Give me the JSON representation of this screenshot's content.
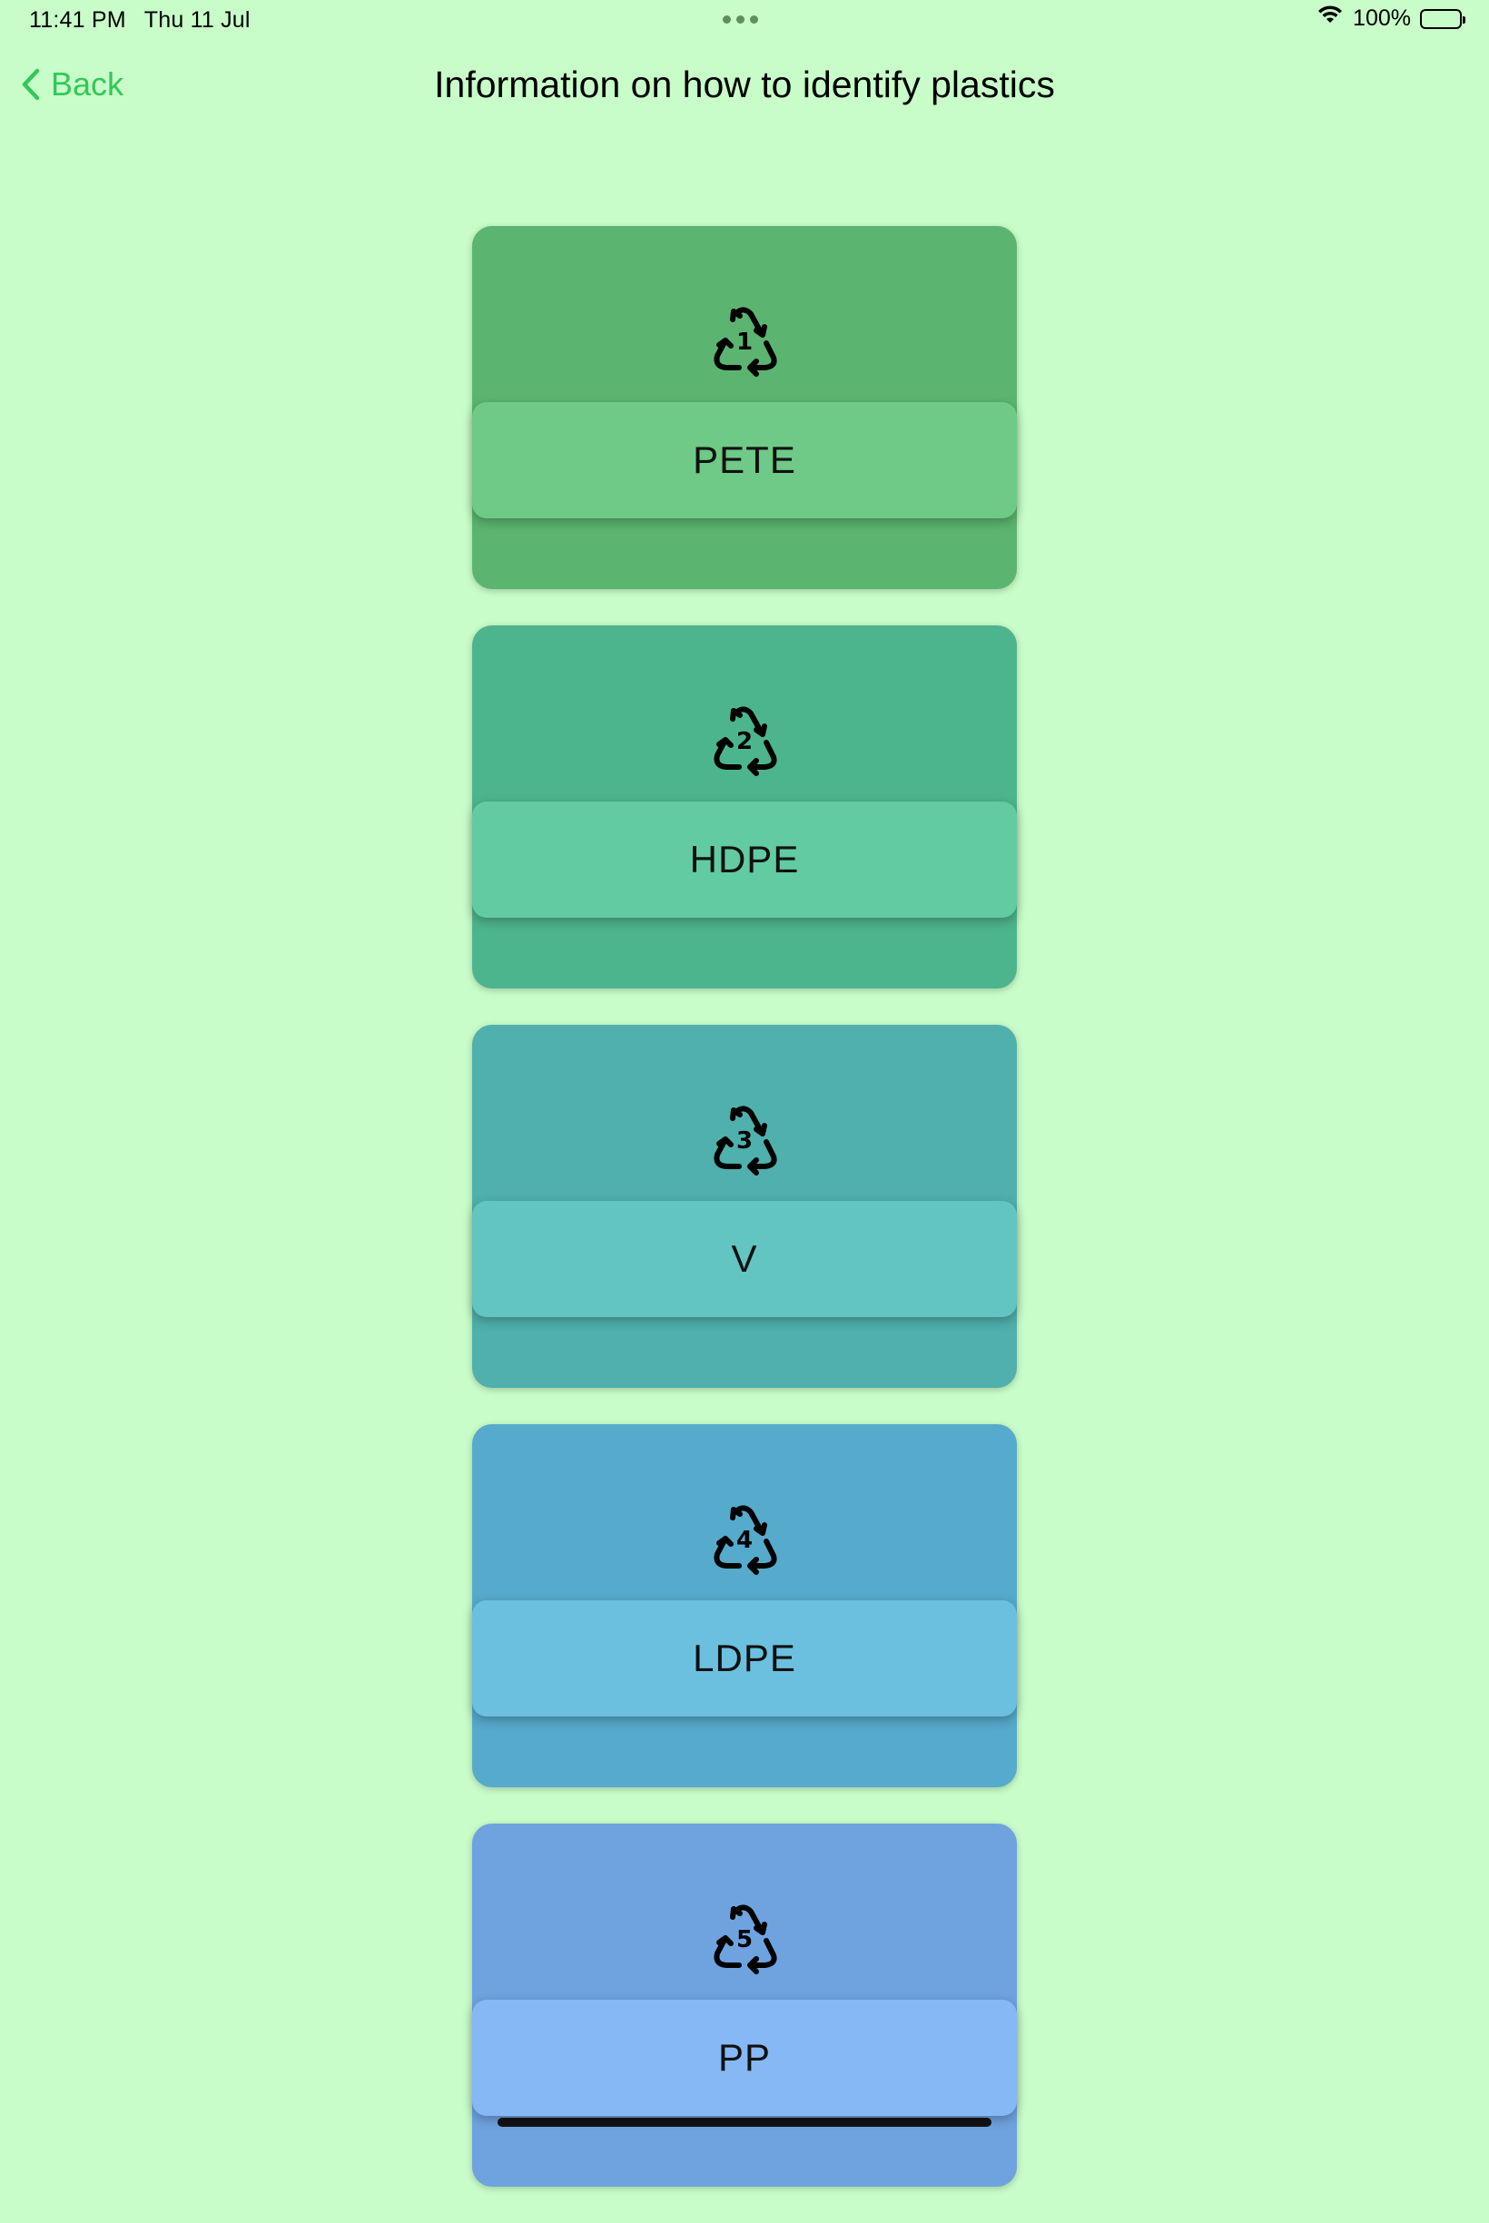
{
  "status_bar": {
    "time": "11:41 PM",
    "date": "Thu 11 Jul",
    "battery": "100%",
    "battery_level": 1.0
  },
  "nav": {
    "back_label": "Back",
    "title": "Information on how to identify plastics"
  },
  "cards": [
    {
      "code": "1",
      "label": "PETE",
      "color": "#5bb570",
      "bar_color": "#6eca86",
      "icon": "recycle-1-icon"
    },
    {
      "code": "2",
      "label": "HDPE",
      "color": "#4db58d",
      "bar_color": "#62cba1",
      "icon": "recycle-2-icon"
    },
    {
      "code": "3",
      "label": "V",
      "color": "#4fb0ad",
      "bar_color": "#62c5c1",
      "icon": "recycle-3-icon"
    },
    {
      "code": "4",
      "label": "LDPE",
      "color": "#56aacb",
      "bar_color": "#6cc0df",
      "icon": "recycle-4-icon"
    },
    {
      "code": "5",
      "label": "PP",
      "color": "#6ea3e0",
      "bar_color": "#86b8f5",
      "icon": "recycle-5-icon"
    }
  ],
  "colors": {
    "background": "#c8fdc9",
    "accent": "#34c759"
  }
}
